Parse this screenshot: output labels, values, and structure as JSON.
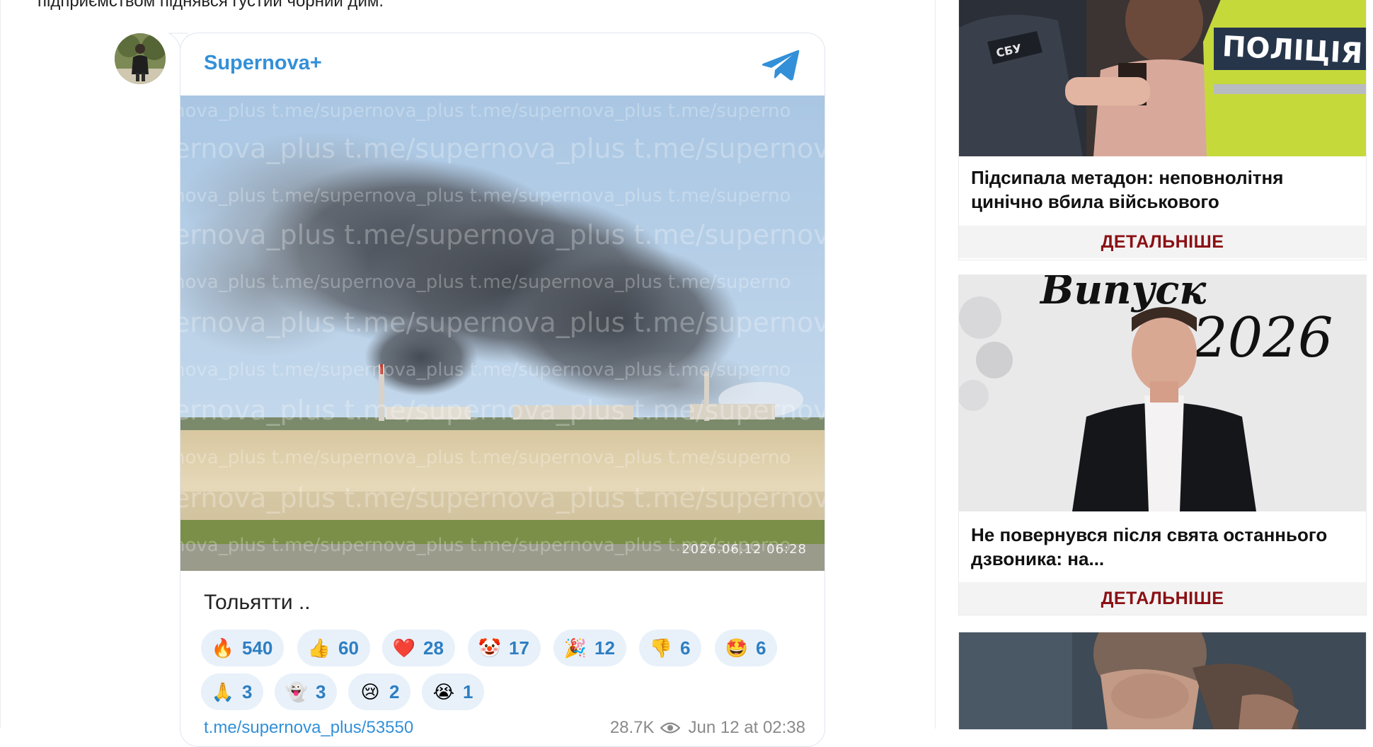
{
  "article": {
    "top_text": "підприємством піднявся густий чорний дим."
  },
  "telegram_post": {
    "channel_name": "Supernova+",
    "photo_timestamp": "2026.06.12 06:28",
    "caption": "Тольятти ..",
    "reactions": [
      {
        "emoji": "🔥",
        "count": "540",
        "icon": "fire-icon"
      },
      {
        "emoji": "👍",
        "count": "60",
        "icon": "thumbs-up-icon"
      },
      {
        "emoji": "❤️",
        "count": "28",
        "icon": "heart-icon"
      },
      {
        "emoji": "🤡",
        "count": "17",
        "icon": "clown-icon"
      },
      {
        "emoji": "🎉",
        "count": "12",
        "icon": "party-popper-icon"
      },
      {
        "emoji": "👎",
        "count": "6",
        "icon": "thumbs-down-icon"
      },
      {
        "emoji": "🤩",
        "count": "6",
        "icon": "star-struck-icon"
      },
      {
        "emoji": "🙏",
        "count": "3",
        "icon": "pray-icon"
      },
      {
        "emoji": "👻",
        "count": "3",
        "icon": "ghost-icon"
      },
      {
        "emoji": "😢",
        "count": "2",
        "icon": "crying-face-icon"
      },
      {
        "emoji": "😭",
        "count": "1",
        "icon": "sobbing-face-icon"
      }
    ],
    "post_link": "t.me/supernova_plus/53550",
    "views": "28.7K",
    "date": "Jun 12 at 02:38"
  },
  "sidebar": {
    "cards": [
      {
        "title": "Підсипала метадон: неповнолітня цинічно вбила військового",
        "more_label": "ДЕТАЛЬНІШЕ"
      },
      {
        "title": "Не повернувся після свята останнього дзвоника: на...",
        "more_label": "ДЕТАЛЬНІШЕ"
      },
      {
        "title": "",
        "more_label": ""
      }
    ]
  },
  "colors": {
    "telegram_blue": "#3390d8",
    "reaction_bg": "#e8f1fa",
    "more_red": "#8b1014"
  }
}
